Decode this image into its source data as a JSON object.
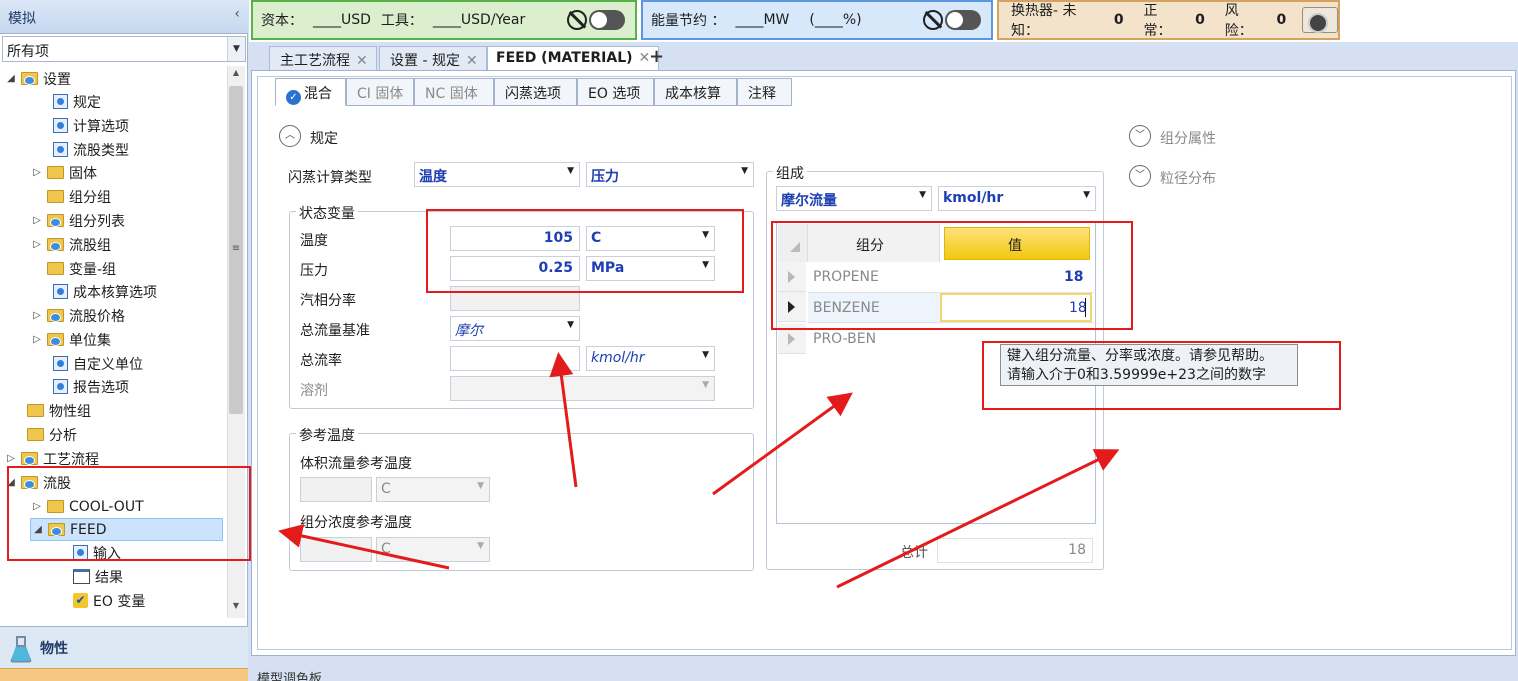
{
  "left_panel": {
    "title": "模拟",
    "collapse": "‹",
    "filter_value": "所有项",
    "tree": [
      {
        "label": "设置"
      },
      {
        "label": "规定"
      },
      {
        "label": "计算选项"
      },
      {
        "label": "流股类型"
      },
      {
        "label": "固体"
      },
      {
        "label": "组分组"
      },
      {
        "label": "组分列表"
      },
      {
        "label": "流股组"
      },
      {
        "label": "变量-组"
      },
      {
        "label": "成本核算选项"
      },
      {
        "label": "流股价格"
      },
      {
        "label": "单位集"
      },
      {
        "label": "自定义单位"
      },
      {
        "label": "报告选项"
      },
      {
        "label": "物性组"
      },
      {
        "label": "分析"
      },
      {
        "label": "工艺流程"
      },
      {
        "label": "流股"
      },
      {
        "label": "COOL-OUT"
      },
      {
        "label": "FEED"
      },
      {
        "label": "输入"
      },
      {
        "label": "结果"
      },
      {
        "label": "EO 变量"
      }
    ],
    "physics_label": "物性"
  },
  "dashboard": {
    "capital_label": "资本：",
    "capital_value": "____USD",
    "utility_label": "工具：",
    "utility_value": "____USD/Year",
    "energy_label": "能量节约 ：",
    "energy_value": "____MW",
    "energy_pct": "(____%)",
    "hx_label": "换热器- 未知：",
    "hx_unknown": "0",
    "hx_normal_label": "正常：",
    "hx_normal": "0",
    "hx_risk_label": "风险：",
    "hx_risk": "0"
  },
  "doc_tabs": [
    {
      "label": "主工艺流程"
    },
    {
      "label": "设置 - 规定"
    },
    {
      "label": "FEED (MATERIAL)"
    }
  ],
  "inner_tabs": [
    {
      "label": "混合"
    },
    {
      "label": "CI 固体"
    },
    {
      "label": "NC 固体"
    },
    {
      "label": "闪蒸选项"
    },
    {
      "label": "EO 选项"
    },
    {
      "label": "成本核算"
    },
    {
      "label": "注释"
    }
  ],
  "form": {
    "spec_label": "规定",
    "flash_type_label": "闪蒸计算类型",
    "flash_type_1": "温度",
    "flash_type_2": "压力",
    "state_group": "状态变量",
    "temp_label": "温度",
    "temp_value": "105",
    "temp_unit": "C",
    "press_label": "压力",
    "press_value": "0.25",
    "press_unit": "MPa",
    "vfrac_label": "汽相分率",
    "basis_label": "总流量基准",
    "basis_value": "摩尔",
    "flow_label": "总流率",
    "flow_unit": "kmol/hr",
    "solvent_label": "溶剂",
    "ref_group": "参考温度",
    "vol_ref_label": "体积流量参考温度",
    "vol_ref_unit": "C",
    "conc_ref_label": "组分浓度参考温度",
    "conc_ref_unit": "C"
  },
  "composition": {
    "group": "组成",
    "basis": "摩尔流量",
    "unit": "kmol/hr",
    "col_component": "组分",
    "col_value": "值",
    "rows": [
      {
        "name": "PROPENE",
        "value": "18"
      },
      {
        "name": "BENZENE",
        "value": "18"
      },
      {
        "name": "PRO-BEN",
        "value": ""
      }
    ],
    "total_label": "总计",
    "total_value": "18"
  },
  "right_links": {
    "comp_props": "组分属性",
    "psd": "粒径分布"
  },
  "tooltip": {
    "line1": "键入组分流量、分率或浓度。请参见帮助。",
    "line2": "请输入介于0和3.59999e+23之间的数字"
  },
  "bottom_bar": "模型调色板",
  "colors": {
    "annotation_red": "#e31b1b",
    "value_blue": "#1d3fb3",
    "header_yellow": "#f7d31a"
  }
}
